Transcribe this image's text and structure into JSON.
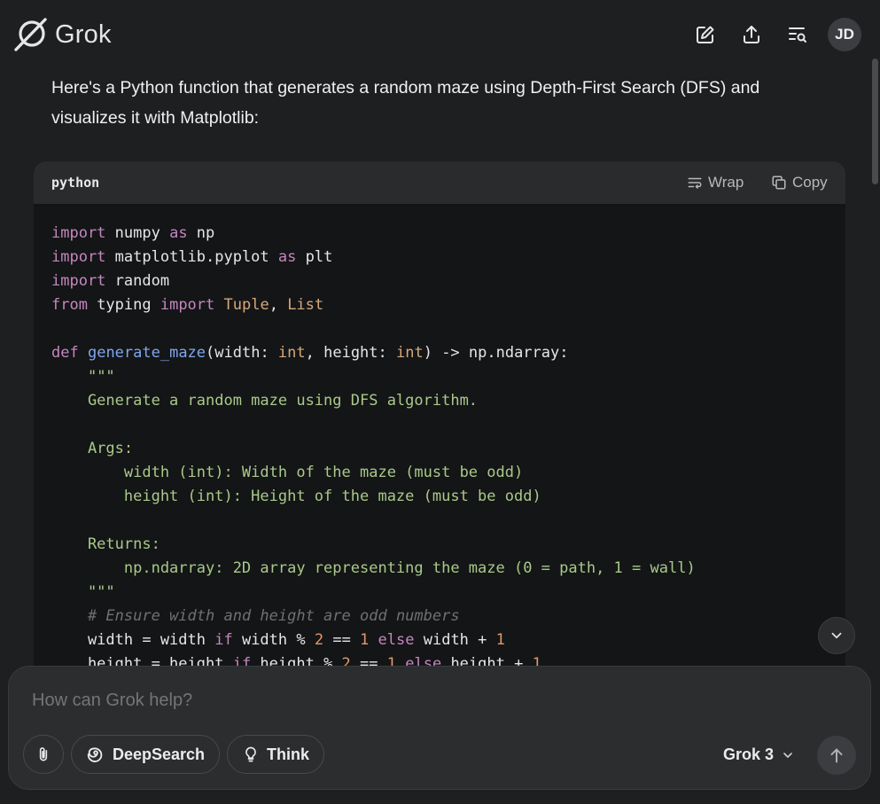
{
  "app": {
    "name": "Grok"
  },
  "header": {
    "icons": [
      "new-chat-icon",
      "share-icon",
      "history-search-icon"
    ],
    "avatar_initials": "JD"
  },
  "message": {
    "text": "Here's a Python function that generates a random maze using Depth-First Search (DFS) and visualizes it with Matplotlib:"
  },
  "code_block": {
    "language": "python",
    "wrap_label": "Wrap",
    "copy_label": "Copy"
  },
  "composer": {
    "placeholder": "How can Grok help?",
    "deepsearch_label": "DeepSearch",
    "think_label": "Think",
    "model_label": "Grok 3"
  },
  "colors": {
    "background": "#1e1f20",
    "code_background": "#141516",
    "keyword": "#c586c0",
    "function": "#7ea7ee",
    "string": "#a9c98a",
    "number": "#e0996b",
    "comment": "#6f7073"
  }
}
